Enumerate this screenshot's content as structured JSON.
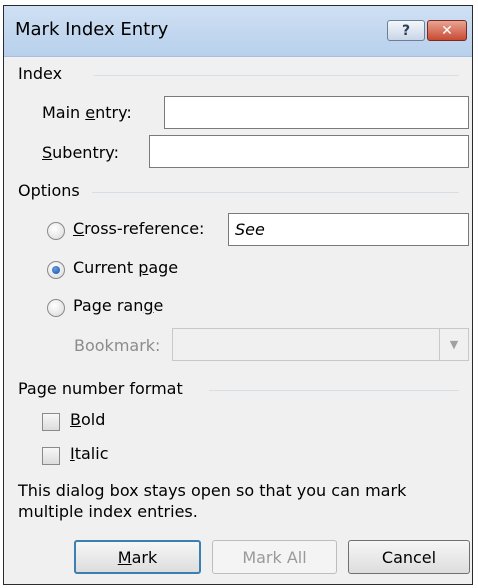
{
  "dialog": {
    "title": "Mark Index Entry"
  },
  "titlebar": {
    "help_glyph": "?",
    "close_glyph": "✕"
  },
  "index": {
    "section_label": "Index",
    "main_entry_label": "Main entry:",
    "main_entry_value": "",
    "subentry_label": "Subentry:",
    "subentry_value": ""
  },
  "options": {
    "section_label": "Options",
    "cross_reference_label": "Cross-reference:",
    "cross_reference_value": "See",
    "current_page_label": "Current page",
    "page_range_label": "Page range",
    "bookmark_label": "Bookmark:",
    "bookmark_value": "",
    "selected": "current_page"
  },
  "format": {
    "section_label": "Page number format",
    "bold_label": "Bold",
    "bold_checked": false,
    "italic_label": "Italic",
    "italic_checked": false
  },
  "info_text": "This dialog box stays open so that you can mark multiple index entries.",
  "buttons": {
    "mark": "Mark",
    "mark_all": "Mark All",
    "cancel": "Cancel"
  }
}
